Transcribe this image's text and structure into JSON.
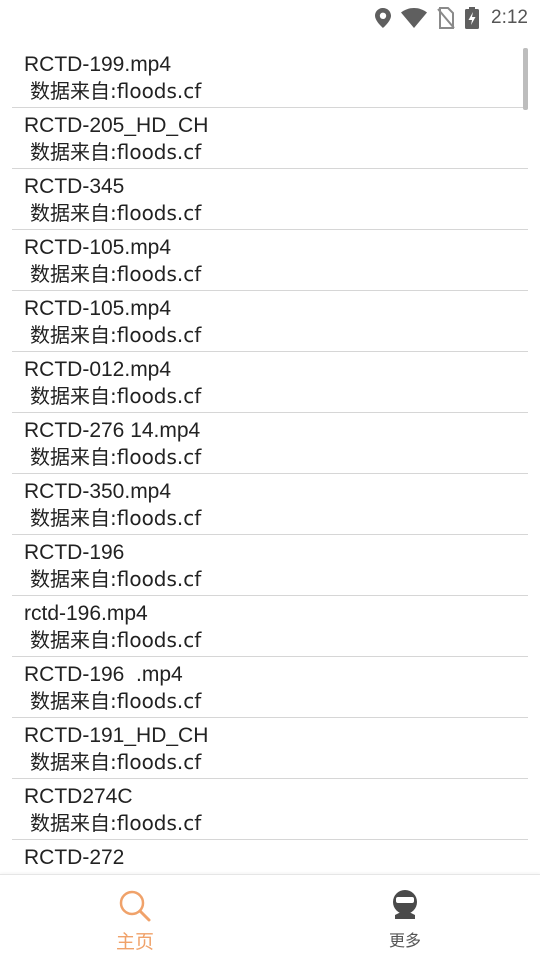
{
  "status_bar": {
    "time": "2:12",
    "icons": [
      "location-icon",
      "wifi-icon",
      "no-sim-icon",
      "battery-charging-icon"
    ]
  },
  "results": [
    {
      "title": "RCTD-199.mp4",
      "source": "数据来自:floods.cf"
    },
    {
      "title": "RCTD-205_HD_CH",
      "source": "数据来自:floods.cf"
    },
    {
      "title": "RCTD-345",
      "source": "数据来自:floods.cf"
    },
    {
      "title": "RCTD-105.mp4",
      "source": "数据来自:floods.cf"
    },
    {
      "title": "RCTD-105.mp4",
      "source": "数据来自:floods.cf"
    },
    {
      "title": "RCTD-012.mp4",
      "source": "数据来自:floods.cf"
    },
    {
      "title": "RCTD-276 14.mp4",
      "source": "数据来自:floods.cf"
    },
    {
      "title": "RCTD-350.mp4",
      "source": "数据来自:floods.cf"
    },
    {
      "title": "RCTD-196",
      "source": "数据来自:floods.cf"
    },
    {
      "title": "rctd-196.mp4",
      "source": "数据来自:floods.cf"
    },
    {
      "title": "RCTD-196  .mp4",
      "source": "数据来自:floods.cf"
    },
    {
      "title": "RCTD-191_HD_CH",
      "source": "数据来自:floods.cf"
    },
    {
      "title": "RCTD274C",
      "source": "数据来自:floods.cf"
    },
    {
      "title": "RCTD-272",
      "source": ""
    }
  ],
  "bottom_nav": {
    "home": {
      "label": "主页",
      "icon": "search-icon",
      "color": "#f0a26a"
    },
    "more": {
      "label": "更多",
      "icon": "more-icon",
      "color": "#555555"
    }
  }
}
